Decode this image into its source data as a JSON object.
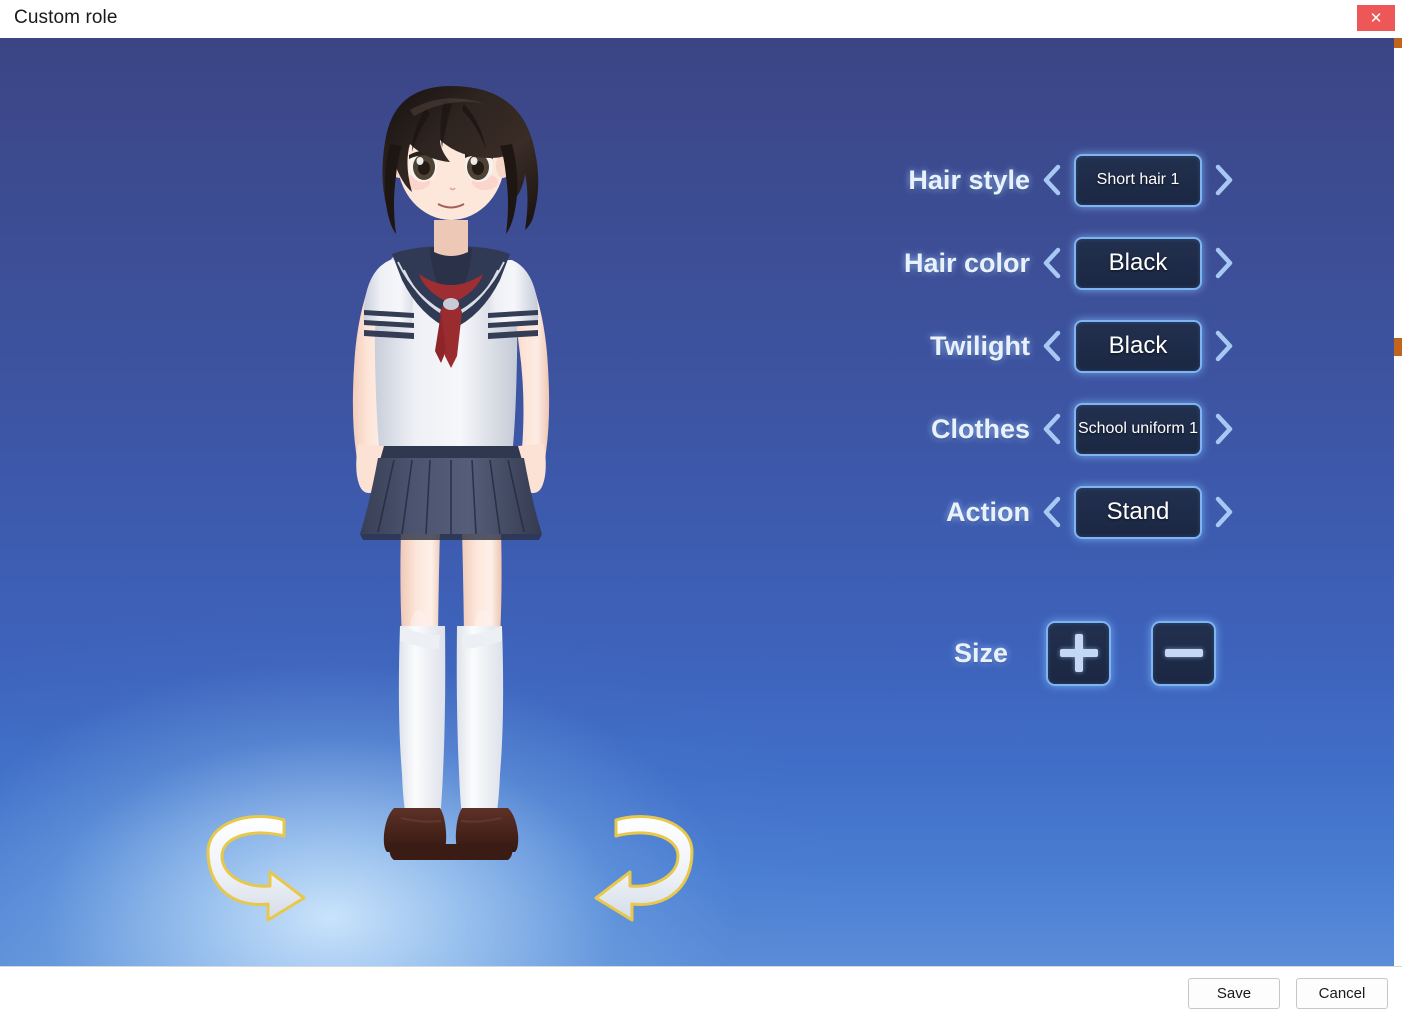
{
  "window": {
    "title": "Custom role",
    "close_icon": "close-icon",
    "close_glyph": "✕"
  },
  "viewport": {
    "background_top_color": "#3b4585",
    "background_bottom_color": "#5a8cd8",
    "glow_color": "#cde6fc",
    "rotate_left": {
      "icon": "rotate-left-arrow-icon",
      "outline_color": "#e8c84a",
      "fill_color": "#f0f4fa"
    },
    "rotate_right": {
      "icon": "rotate-right-arrow-icon",
      "outline_color": "#e8c84a",
      "fill_color": "#f0f4fa"
    },
    "character": {
      "hair_color": "#241c18",
      "skin_color": "#fbe0d2",
      "shirt_color": "#e8ebf2",
      "collar_color": "#313a55",
      "tie_color": "#a02e32",
      "skirt_color": "#464e66",
      "sock_color": "#f7f8fa",
      "shoe_color": "#4a2620"
    }
  },
  "options": {
    "accent_border": "#7fb4f2",
    "button_fill": "#1f2c49",
    "label_color": "#e9f1fd",
    "prev_icon": "chevron-left-icon",
    "next_icon": "chevron-right-icon",
    "rows": [
      {
        "label": "Hair style",
        "value": "Short hair 1",
        "small": true
      },
      {
        "label": "Hair color",
        "value": "Black",
        "small": false
      },
      {
        "label": "Twilight",
        "value": "Black",
        "small": false
      },
      {
        "label": "Clothes",
        "value": "School uniform 1",
        "small": true
      },
      {
        "label": "Action",
        "value": "Stand",
        "small": false
      }
    ],
    "size": {
      "label": "Size",
      "increase_icon": "plus-icon",
      "decrease_icon": "minus-icon"
    }
  },
  "footer": {
    "save_label": "Save",
    "cancel_label": "Cancel"
  }
}
